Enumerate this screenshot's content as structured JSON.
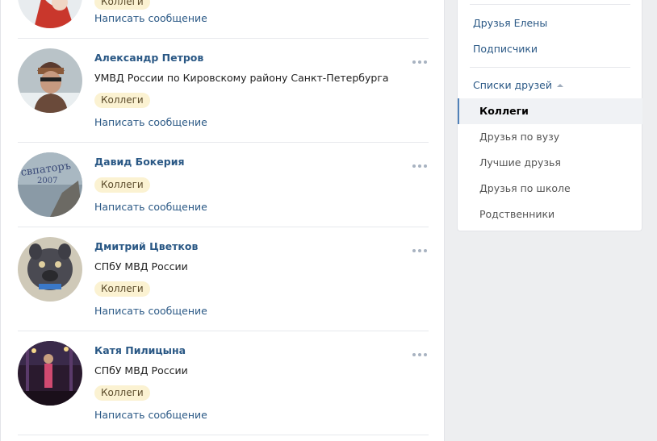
{
  "friends": [
    {
      "tag": "Коллеги",
      "message_link": "Написать сообщение"
    },
    {
      "name": "Александр Петров",
      "info": "УМВД России по Кировскому району Санкт-Петербурга",
      "tag": "Коллеги",
      "message_link": "Написать сообщение"
    },
    {
      "name": "Давид Бокерия",
      "tag": "Коллеги",
      "message_link": "Написать сообщение"
    },
    {
      "name": "Дмитрий Цветков",
      "info": "СПбУ МВД России",
      "tag": "Коллеги",
      "message_link": "Написать сообщение"
    },
    {
      "name": "Катя Пилицына",
      "info": "СПбУ МВД России",
      "tag": "Коллеги",
      "message_link": "Написать сообщение"
    }
  ],
  "sidebar": {
    "friends_of": "Друзья Елены",
    "subscribers": "Подписчики",
    "friend_lists": "Списки друзей",
    "lists": [
      "Коллеги",
      "Друзья по вузу",
      "Лучшие друзья",
      "Друзья по школе",
      "Родственники"
    ],
    "active_list": "Коллеги"
  },
  "colors": {
    "link": "#2a5885",
    "tag_bg": "#fbf2d2",
    "page_bg": "#edeef0",
    "active_marker": "#5181b8"
  }
}
